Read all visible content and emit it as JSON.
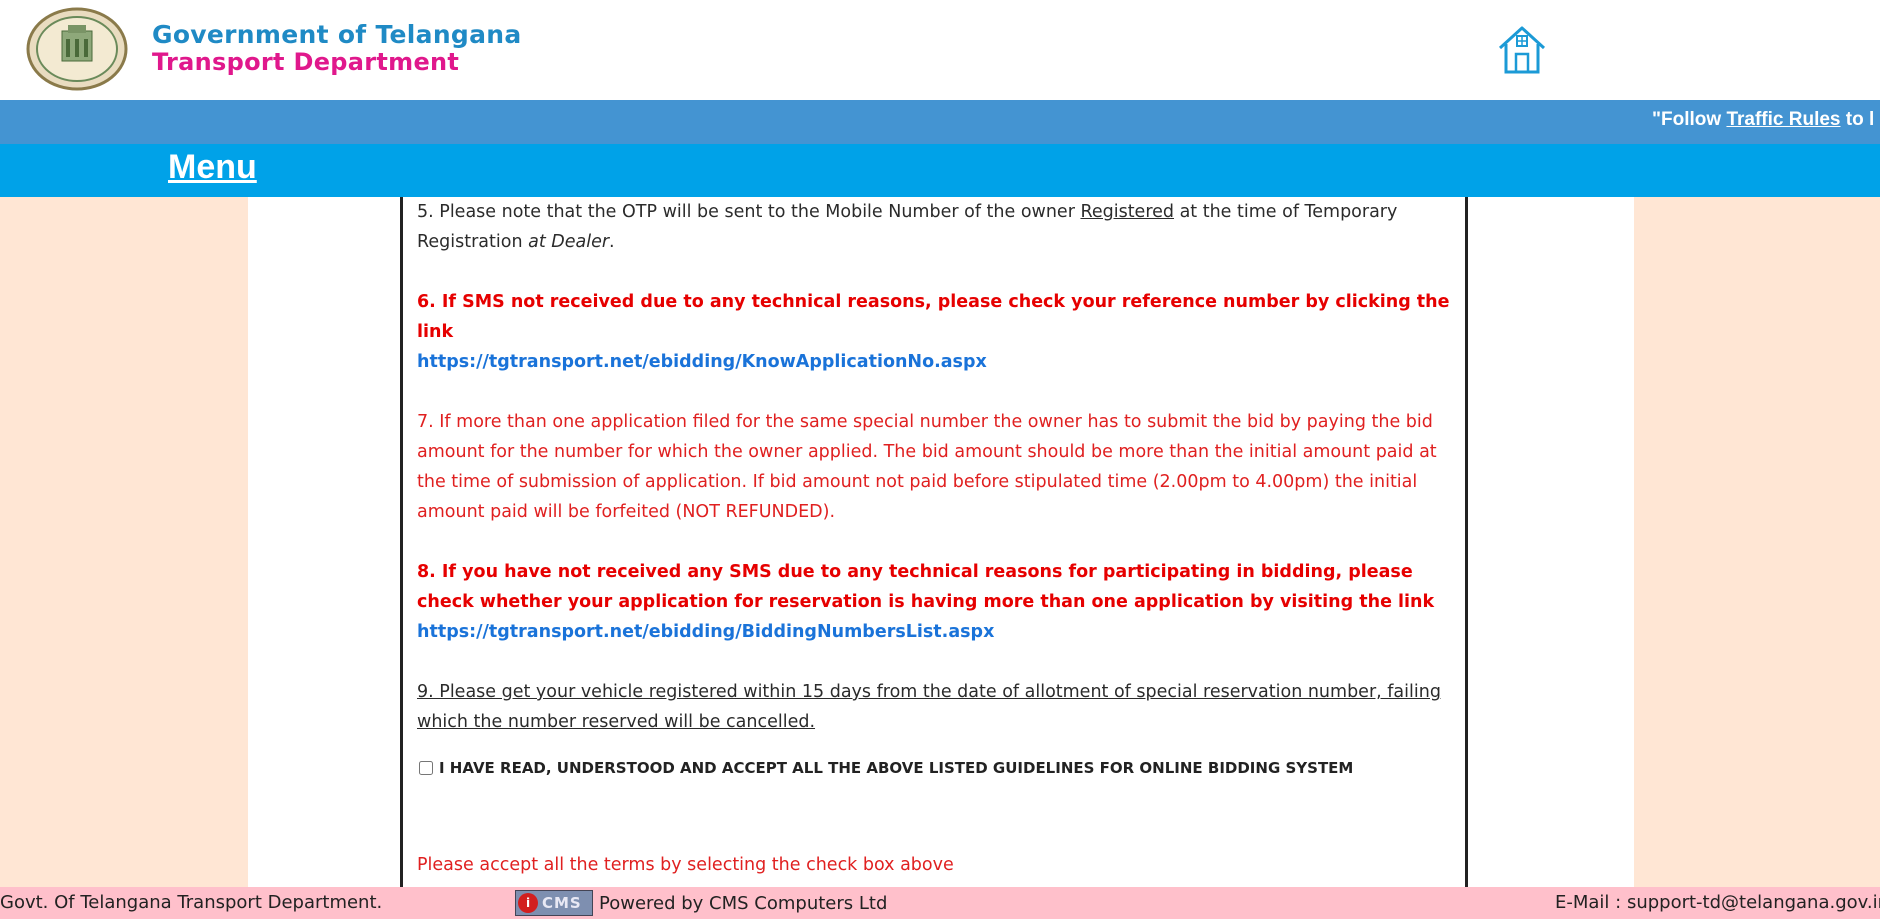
{
  "header": {
    "title_main": "Government of Telangana",
    "title_sub": "Transport Department"
  },
  "marquee": {
    "prefix": "\"Follow ",
    "link_text": "Traffic Rules",
    "suffix": " to l"
  },
  "menu": {
    "label": "Menu"
  },
  "guidelines": {
    "item5_text_a": "5. Please note that the OTP will be sent to the Mobile Number of the owner ",
    "item5_registered": "Registered",
    "item5_text_b": " at the time of Temporary Registration ",
    "item5_at_dealer": "at Dealer",
    "item5_end": ".",
    "item6_text": "6. If SMS not received due to any technical reasons, please check your reference number by clicking the link",
    "item6_link": "https://tgtransport.net/ebidding/KnowApplicationNo.aspx",
    "item7_text": "7. If more than one application filed for the same special number the owner has to submit the bid by paying the bid amount for the number for which the owner applied. The bid amount should be more than the initial amount paid at the time of submission of application. If bid amount not paid before stipulated time (2.00pm to 4.00pm) the initial amount paid will be forfeited (NOT REFUNDED).",
    "item8_text": "8. If you have not received any SMS due to any technical reasons for participating in bidding, please check whether your application for reservation is having more than one application by visiting the link",
    "item8_link": "https://tgtransport.net/ebidding/BiddingNumbersList.aspx",
    "item9_text": "9. Please get your vehicle registered within 15 days from the date of allotment of special reservation number, failing which the number reserved will be cancelled.",
    "accept_label": "I HAVE READ, UNDERSTOOD AND ACCEPT ALL THE ABOVE LISTED GUIDELINES FOR ONLINE BIDDING SYSTEM",
    "accept_checked": false,
    "warning": "Please accept all the terms by selecting the check box above"
  },
  "footer": {
    "left": "Govt. Of Telangana Transport Department.",
    "cms_logo_text": "CMS",
    "powered_by": "Powered by CMS Computers Ltd",
    "email": "E-Mail : support-td@telangana.gov.in"
  },
  "colors": {
    "marquee_bg": "#4494d2",
    "menu_bg": "#00a2e8",
    "side_bg": "#ffe6d4",
    "footer_bg": "#ffc0cb",
    "title_blue": "#1f8ac5",
    "title_pink": "#e0188c",
    "warning_red": "#e02020",
    "link_blue": "#1a73d9"
  },
  "icons": {
    "emblem": "telangana-emblem-icon",
    "home": "home-icon"
  }
}
